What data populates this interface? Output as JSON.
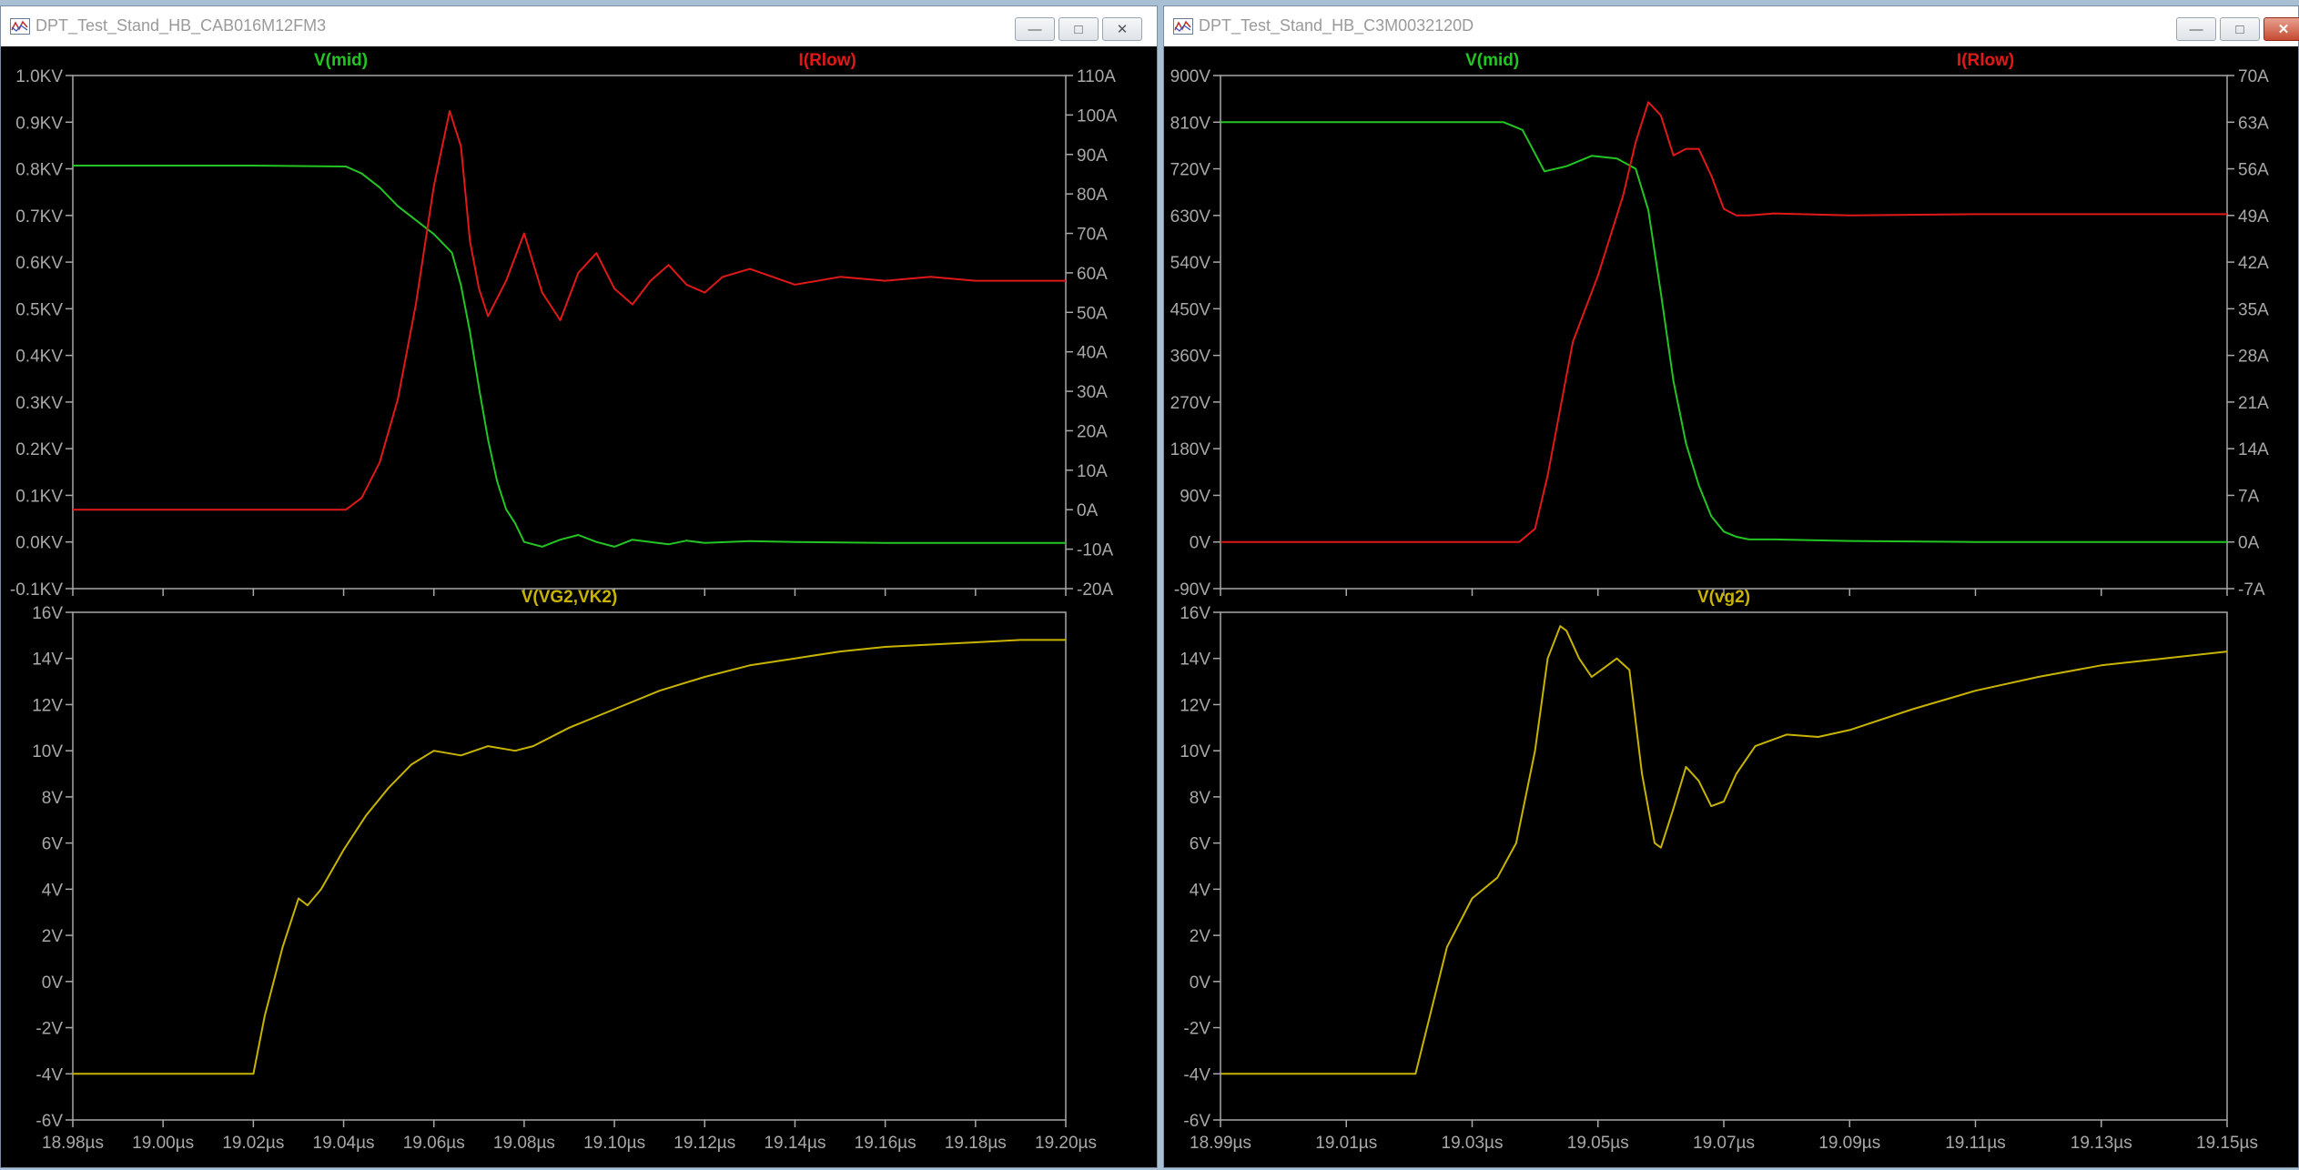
{
  "windows": [
    {
      "title": "DPT_Test_Stand_HB_CAB016M12FM3",
      "buttons": {
        "minimize": "—",
        "maximize": "□",
        "close": "✕"
      },
      "panes": [
        {
          "traces": [
            {
              "name": "V(mid)",
              "color": "#22c522",
              "axis": "left"
            },
            {
              "name": "I(Rlow)",
              "color": "#e01818",
              "axis": "right"
            }
          ],
          "left_ticks": [
            "1.0KV",
            "0.9KV",
            "0.8KV",
            "0.7KV",
            "0.6KV",
            "0.5KV",
            "0.4KV",
            "0.3KV",
            "0.2KV",
            "0.1KV",
            "0.0KV",
            "-0.1KV"
          ],
          "right_ticks": [
            "110A",
            "100A",
            "90A",
            "80A",
            "70A",
            "60A",
            "50A",
            "40A",
            "30A",
            "20A",
            "10A",
            "0A",
            "-10A",
            "-20A"
          ]
        },
        {
          "traces": [
            {
              "name": "V(VG2,VK2)",
              "color": "#c8b400",
              "axis": "left"
            }
          ],
          "left_ticks": [
            "16V",
            "14V",
            "12V",
            "10V",
            "8V",
            "6V",
            "4V",
            "2V",
            "0V",
            "-2V",
            "-4V",
            "-6V"
          ],
          "right_ticks": []
        }
      ],
      "x_ticks": [
        "18.98µs",
        "19.00µs",
        "19.02µs",
        "19.04µs",
        "19.06µs",
        "19.08µs",
        "19.10µs",
        "19.12µs",
        "19.14µs",
        "19.16µs",
        "19.18µs",
        "19.20µs"
      ]
    },
    {
      "title": "DPT_Test_Stand_HB_C3M0032120D",
      "buttons": {
        "minimize": "—",
        "maximize": "□",
        "close": "✕"
      },
      "panes": [
        {
          "traces": [
            {
              "name": "V(mid)",
              "color": "#22c522",
              "axis": "left"
            },
            {
              "name": "I(Rlow)",
              "color": "#e01818",
              "axis": "right"
            }
          ],
          "left_ticks": [
            "900V",
            "810V",
            "720V",
            "630V",
            "540V",
            "450V",
            "360V",
            "270V",
            "180V",
            "90V",
            "0V",
            "-90V"
          ],
          "right_ticks": [
            "70A",
            "63A",
            "56A",
            "49A",
            "42A",
            "35A",
            "28A",
            "21A",
            "14A",
            "7A",
            "0A",
            "-7A"
          ]
        },
        {
          "traces": [
            {
              "name": "V(vg2)",
              "color": "#c8b400",
              "axis": "left"
            }
          ],
          "left_ticks": [
            "16V",
            "14V",
            "12V",
            "10V",
            "8V",
            "6V",
            "4V",
            "2V",
            "0V",
            "-2V",
            "-4V",
            "-6V"
          ],
          "right_ticks": []
        }
      ],
      "x_ticks": [
        "18.99µs",
        "19.01µs",
        "19.03µs",
        "19.05µs",
        "19.07µs",
        "19.09µs",
        "19.11µs",
        "19.13µs",
        "19.15µs"
      ]
    }
  ],
  "chart_data": [
    {
      "type": "line",
      "window": "DPT_Test_Stand_HB_CAB016M12FM3",
      "pane": "top",
      "x_unit": "µs",
      "xlim": [
        18.98,
        19.2
      ],
      "ylim_left": [
        -0.1,
        1.0
      ],
      "left_unit": "KV",
      "ylim_right": [
        -20,
        110
      ],
      "right_unit": "A",
      "series": [
        {
          "name": "V(mid)",
          "axis": "left",
          "color": "#22c522",
          "x": [
            18.98,
            19.02,
            19.0405,
            19.044,
            19.048,
            19.052,
            19.056,
            19.06,
            19.064,
            19.066,
            19.068,
            19.07,
            19.072,
            19.074,
            19.076,
            19.078,
            19.08,
            19.084,
            19.088,
            19.092,
            19.096,
            19.1,
            19.104,
            19.108,
            19.112,
            19.116,
            19.12,
            19.13,
            19.14,
            19.16,
            19.2
          ],
          "y": [
            0.807,
            0.807,
            0.805,
            0.79,
            0.76,
            0.72,
            0.69,
            0.66,
            0.62,
            0.55,
            0.45,
            0.33,
            0.22,
            0.13,
            0.07,
            0.04,
            0.0,
            -0.01,
            0.005,
            0.015,
            0.0,
            -0.01,
            0.005,
            0.0,
            -0.005,
            0.003,
            -0.002,
            0.002,
            0.0,
            -0.002,
            -0.002
          ]
        },
        {
          "name": "I(Rlow)",
          "axis": "right",
          "color": "#e01818",
          "x": [
            18.98,
            19.02,
            19.0405,
            19.044,
            19.048,
            19.052,
            19.056,
            19.06,
            19.0635,
            19.066,
            19.068,
            19.07,
            19.072,
            19.076,
            19.08,
            19.084,
            19.088,
            19.092,
            19.096,
            19.1,
            19.104,
            19.108,
            19.112,
            19.116,
            19.12,
            19.124,
            19.13,
            19.14,
            19.15,
            19.16,
            19.17,
            19.18,
            19.2
          ],
          "y": [
            0,
            0,
            0,
            3,
            12,
            28,
            52,
            82,
            101,
            92,
            68,
            56,
            49,
            58,
            70,
            55,
            48,
            60,
            65,
            56,
            52,
            58,
            62,
            57,
            55,
            59,
            61,
            57,
            59,
            58,
            59,
            58,
            58
          ]
        }
      ]
    },
    {
      "type": "line",
      "window": "DPT_Test_Stand_HB_CAB016M12FM3",
      "pane": "bottom",
      "x_unit": "µs",
      "xlim": [
        18.98,
        19.2
      ],
      "ylim": [
        -6,
        16
      ],
      "y_unit": "V",
      "series": [
        {
          "name": "V(VG2,VK2)",
          "color": "#c8b400",
          "x": [
            18.98,
            19.02,
            19.0225,
            19.0265,
            19.03,
            19.032,
            19.035,
            19.04,
            19.045,
            19.05,
            19.055,
            19.06,
            19.066,
            19.072,
            19.078,
            19.082,
            19.09,
            19.1,
            19.11,
            19.12,
            19.13,
            19.14,
            19.15,
            19.16,
            19.17,
            19.18,
            19.19,
            19.2
          ],
          "y": [
            -4,
            -4,
            -1.5,
            1.5,
            3.6,
            3.3,
            4,
            5.7,
            7.2,
            8.4,
            9.4,
            10.0,
            9.8,
            10.2,
            10.0,
            10.2,
            11.0,
            11.8,
            12.6,
            13.2,
            13.7,
            14.0,
            14.3,
            14.5,
            14.6,
            14.7,
            14.8,
            14.8
          ]
        }
      ]
    },
    {
      "type": "line",
      "window": "DPT_Test_Stand_HB_C3M0032120D",
      "pane": "top",
      "x_unit": "µs",
      "xlim": [
        18.99,
        19.15
      ],
      "ylim_left": [
        -90,
        900
      ],
      "left_unit": "V",
      "ylim_right": [
        -7,
        70
      ],
      "right_unit": "A",
      "series": [
        {
          "name": "V(mid)",
          "axis": "left",
          "color": "#22c522",
          "x": [
            18.99,
            19.035,
            19.038,
            19.0415,
            19.045,
            19.049,
            19.053,
            19.056,
            19.058,
            19.06,
            19.062,
            19.064,
            19.066,
            19.068,
            19.07,
            19.072,
            19.074,
            19.078,
            19.09,
            19.11,
            19.15
          ],
          "y": [
            810,
            810,
            795,
            715,
            725,
            745,
            740,
            720,
            640,
            480,
            310,
            190,
            110,
            50,
            20,
            10,
            5,
            5,
            2,
            0,
            0
          ]
        },
        {
          "name": "I(Rlow)",
          "axis": "right",
          "color": "#e01818",
          "x": [
            18.99,
            19.0375,
            19.04,
            19.042,
            19.046,
            19.05,
            19.054,
            19.056,
            19.058,
            19.06,
            19.062,
            19.064,
            19.066,
            19.068,
            19.07,
            19.072,
            19.074,
            19.078,
            19.09,
            19.11,
            19.15
          ],
          "y": [
            0,
            0,
            2,
            10,
            30,
            40,
            52,
            60,
            66,
            64,
            58,
            59,
            59,
            55,
            50,
            49,
            49,
            49.3,
            49,
            49.2,
            49.2
          ]
        }
      ]
    },
    {
      "type": "line",
      "window": "DPT_Test_Stand_HB_C3M0032120D",
      "pane": "bottom",
      "x_unit": "µs",
      "xlim": [
        18.99,
        19.15
      ],
      "ylim": [
        -6,
        16
      ],
      "y_unit": "V",
      "series": [
        {
          "name": "V(vg2)",
          "color": "#c8b400",
          "x": [
            18.99,
            19.021,
            19.026,
            19.03,
            19.034,
            19.037,
            19.04,
            19.042,
            19.044,
            19.045,
            19.047,
            19.049,
            19.051,
            19.053,
            19.055,
            19.057,
            19.059,
            19.06,
            19.062,
            19.064,
            19.066,
            19.068,
            19.07,
            19.072,
            19.075,
            19.08,
            19.085,
            19.09,
            19.1,
            19.11,
            19.12,
            19.13,
            19.14,
            19.15
          ],
          "y": [
            -4,
            -4,
            1.5,
            3.6,
            4.5,
            6,
            10,
            14,
            15.4,
            15.2,
            14,
            13.2,
            13.6,
            14,
            13.5,
            9,
            6,
            5.8,
            7.5,
            9.3,
            8.7,
            7.6,
            7.8,
            9,
            10.2,
            10.7,
            10.6,
            10.9,
            11.8,
            12.6,
            13.2,
            13.7,
            14.0,
            14.3
          ]
        }
      ]
    }
  ]
}
